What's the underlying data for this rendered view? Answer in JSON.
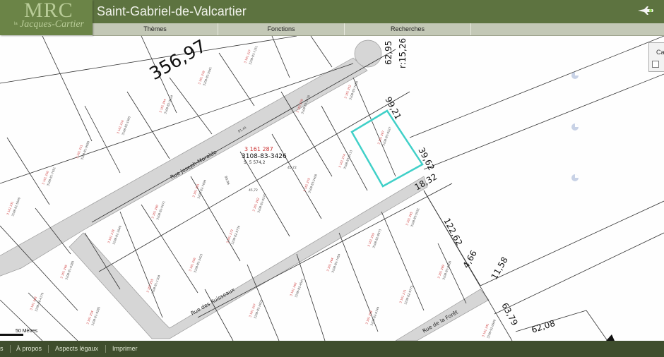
{
  "app": {
    "logo_text": "MRC",
    "logo_subtitle": "Jacques-Cartier",
    "logo_prefix": "la",
    "title": "Saint-Gabriel-de-Valcartier"
  },
  "menu": [
    {
      "label": "Thèmes"
    },
    {
      "label": "Fonctions"
    },
    {
      "label": "Recherches"
    }
  ],
  "map": {
    "dimensions": {
      "d1": "356,97",
      "d2": "62,95",
      "d3": "r:15,26",
      "d4": "99,21",
      "d5": "39,62",
      "d6": "18,32",
      "d7": "122,62",
      "d8": "4,66",
      "d9": "11,58",
      "d10": "63,79",
      "d11": "62,08"
    },
    "lot_number": "3 161 287",
    "lot_matricule": "3108-83-3426",
    "lot_area": "S. 5 574,2",
    "lot_small_dims": {
      "a": "81,44",
      "b": "45,72",
      "c": "45,72",
      "e": "80,96"
    },
    "streets": {
      "s1": "Rue Joseph-Moraldo",
      "s2": "Rue des Ruisseaux",
      "s3": "Rue de la Forêt"
    },
    "scale_label": "50 Mètres",
    "side_panel_label": "Ca",
    "highlight_color": "#40d0c8",
    "road_color": "#d6d6d6"
  },
  "footer": [
    {
      "label": "s"
    },
    {
      "label": "À propos"
    },
    {
      "label": "Aspects légaux"
    },
    {
      "label": "Imprimer"
    }
  ]
}
